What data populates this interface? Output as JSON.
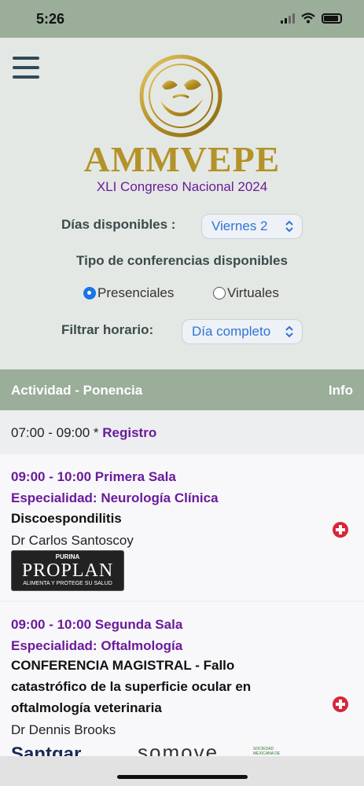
{
  "status": {
    "time": "5:26"
  },
  "header": {
    "brand": "AMMVEPE",
    "subtitle": "XLI Congreso Nacional 2024"
  },
  "filters": {
    "dias_label": "Días disponibles :",
    "dias_value": "Viernes 2",
    "tipo_label": "Tipo de conferencias disponibles",
    "options": [
      {
        "label": "Presenciales",
        "selected": true
      },
      {
        "label": "Virtuales",
        "selected": false
      }
    ],
    "horario_label": "Filtrar horario:",
    "horario_value": "Día completo"
  },
  "table": {
    "header_left": "Actividad - Ponencia",
    "header_right": "Info",
    "registro": {
      "time": "07:00 - 09:00 *",
      "label": "Registro"
    },
    "items": [
      {
        "time_room": "09:00 - 10:00 Primera Sala",
        "especialidad": "Especialidad: Neurología Clínica",
        "title": "Discoespondilitis",
        "speaker": "Dr Carlos Santoscoy",
        "sponsor": {
          "top": "PURINA",
          "name": "PROPLAN",
          "tagline": "ALIMENTA Y PROTEGE SU SALUD"
        }
      },
      {
        "time_room": "09:00 - 10:00 Segunda Sala",
        "especialidad": "Especialidad: Oftalmología",
        "title": "CONFERENCIA MAGISTRAL - Fallo catastrófico de la superficie ocular en oftalmología veterinaria",
        "speaker": "Dr Dennis Brooks",
        "sponsors": [
          "Santgar",
          "somove",
          "SOCIEDAD MEXICANA DE"
        ]
      }
    ]
  },
  "colors": {
    "accent": "#6a1b9a",
    "header_green": "#9aae9a",
    "gold": "#b39329",
    "add_red": "#d8263a"
  },
  "icons": [
    "menu-icon",
    "chevron-updown-icon",
    "plus-circle-icon",
    "wifi-icon",
    "battery-icon",
    "signal-icon"
  ]
}
